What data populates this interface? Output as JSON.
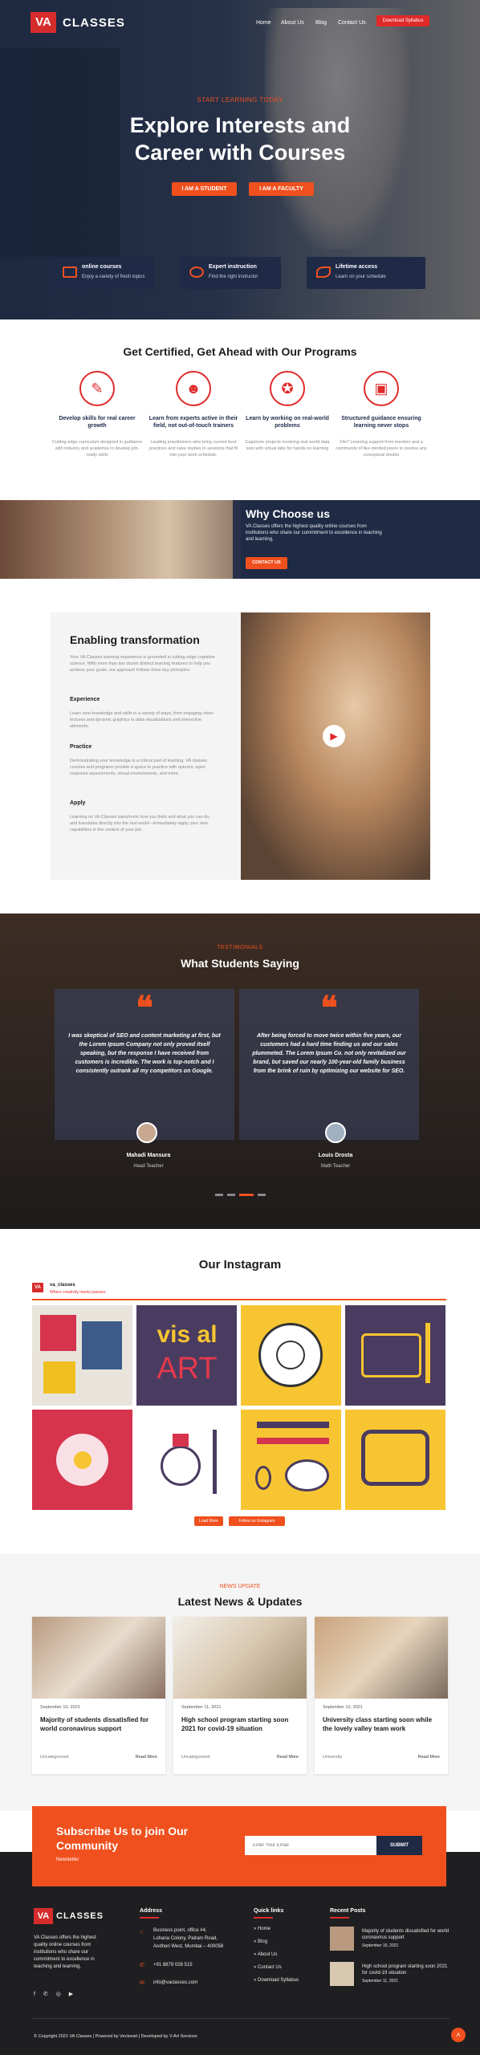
{
  "header": {
    "logo_mark": "VA",
    "logo_text": "CLASSES",
    "nav": [
      "Home",
      "About Us",
      "Blog",
      "Contact Us"
    ],
    "cta": "Download Syllabus"
  },
  "hero": {
    "kicker": "START LEARNING TODAY",
    "title_line1": "Explore Interests and",
    "title_line2": "Career with Courses",
    "btn_student": "I AM A STUDENT",
    "btn_faculty": "I AM A FACULTY",
    "features": [
      {
        "title": "online courses",
        "sub": "Enjoy a variety of fresh topics",
        "icon": "video-icon"
      },
      {
        "title": "Expert instruction",
        "sub": "Find the right instructor",
        "icon": "certificate-icon"
      },
      {
        "title": "Lifetime access",
        "sub": "Learn on your schedule",
        "icon": "infinity-icon"
      }
    ]
  },
  "programs": {
    "title": "Get Certified, Get Ahead with Our Programs",
    "items": [
      {
        "title": "Develop skills for real career growth",
        "desc": "Cutting-edge curriculum designed in guidance with industry and academia to develop job-ready skills",
        "icon": "pencil-icon"
      },
      {
        "title": "Learn from experts active in their field, not out-of-touch trainers",
        "desc": "Leading practitioners who bring current best practices and case studies to sessions that fit into your work schedule.",
        "icon": "user-icon"
      },
      {
        "title": "Learn by working on real-world problems",
        "desc": "Capstone projects involving real world data sets with virtual labs for hands-on learning",
        "icon": "medal-icon"
      },
      {
        "title": "Structured guidance ensuring learning never stops",
        "desc": "24x7 Learning support from mentors and a community of like-minded peers to resolve any conceptual doubts",
        "icon": "briefcase-icon"
      }
    ]
  },
  "why": {
    "title": "Why Choose us",
    "text": "VA Classes offers the highest quality online courses from institutions who share our commitment to excellence in teaching and learning.",
    "btn": "CONTACT US"
  },
  "enabling": {
    "title": "Enabling transformation",
    "intro": "Your VA Classes learning experience is grounded in cutting edge cognitive science. With more than two dozen distinct learning features to help you achieve your goals, our approach follows three key principles:",
    "blocks": [
      {
        "title": "Experience",
        "text": "Learn new knowledge and skills in a variety of ways, from engaging video lectures and dynamic graphics to data visualizations and interactive elements."
      },
      {
        "title": "Practice",
        "text": "Demonstrating your knowledge is a critical part of learning. VA classes courses and programs provide a space to practice with quizzes, open response assessments, virtual environments, and more."
      },
      {
        "title": "Apply",
        "text": "Learning on VA Classes transforms how you think and what you can do, and translates directly into the real world—immediately apply your new capabilities in the context of your job."
      }
    ]
  },
  "testimonials": {
    "kicker": "TESTIMONIALS",
    "title": "What Students Saying",
    "items": [
      {
        "quote": "I was skeptical of SEO and content marketing at first, but the Lorem Ipsum Company not only proved itself speaking, but the response I have received from customers is incredible. The work is top-notch and I consistently outrank all my competitors on Google.",
        "name": "Mahadi Mansura",
        "role": "Head Teacher"
      },
      {
        "quote": "After being forced to move twice within five years, our customers had a hard time finding us and our sales plummeted. The Lorem Ipsum Co. not only revitalized our brand, but saved our nearly 100-year-old family business from the brink of ruin by optimizing our website for SEO.",
        "name": "Louis Drosta",
        "role": "Math Teacher"
      }
    ]
  },
  "instagram": {
    "title": "Our Instagram",
    "handle": "va_classes",
    "handle_sub": "Where creativity meets passion",
    "load_more": "Load More",
    "follow": "Follow on Instagram",
    "tiles": [
      "art-supplies-tile",
      "visual-art-tile",
      "mandala-tile",
      "tablet-pen-tile",
      "bird-art-tile",
      "ink-pot-tile",
      "paint-tools-tile",
      "frame-tile"
    ]
  },
  "news": {
    "kicker": "NEWS UPDATE",
    "title": "Latest News & Updates",
    "items": [
      {
        "date": "September 10, 2021",
        "title": "Majority of students dissatisfied for world coronavirus support",
        "cat": "Uncategorized",
        "more": "Read More"
      },
      {
        "date": "September 11, 2021",
        "title": "High school program starting soon 2021 for covid-19 situation",
        "cat": "Uncategorized",
        "more": "Read More"
      },
      {
        "date": "September 10, 2021",
        "title": "University class starting soon while the lovely valley team work",
        "cat": "University",
        "more": "Read More"
      }
    ]
  },
  "subscribe": {
    "title_line1": "Subscribe Us to join Our",
    "title_line2": "Community",
    "sub": "Newsletter",
    "placeholder": "Enter Your Email",
    "btn": "SUBMIT"
  },
  "footer": {
    "about": "VA Classes offers the highest quality online courses from institutions who share our commitment to excellence in teaching and learning.",
    "address_title": "Address",
    "address": [
      "Business point, office #4,",
      "Lohana Colony, Palram Road,",
      "Andheri West, Mumbai – 400058"
    ],
    "phone": "+91 8879 028 515",
    "email": "info@vaclasses.com",
    "quick_title": "Quick links",
    "quick": [
      "Home",
      "Blog",
      "About Us",
      "Contact Us",
      "Download Syllabus"
    ],
    "posts_title": "Recent Posts",
    "posts": [
      {
        "title": "Majority of students dissatisfied for world coronavirus support",
        "date": "September 10, 2021"
      },
      {
        "title": "High school program starting soon 2021 for covid-19 situation",
        "date": "September 11, 2021"
      }
    ],
    "copyright": "© Copyright 2021 VA Classes | Powered by Vectorart | Developed by V-Art Services"
  },
  "colors": {
    "accent": "#f0501e",
    "red": "#e02a2a",
    "navy": "#1f2a45"
  }
}
